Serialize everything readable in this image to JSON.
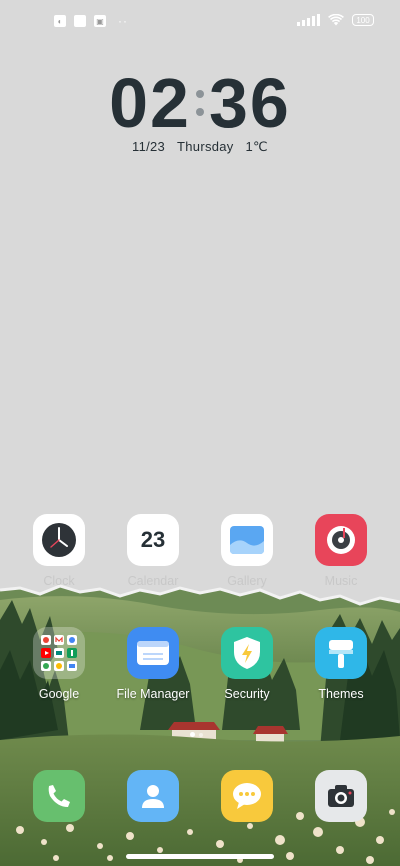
{
  "status_bar": {
    "left_icons": [
      "mi-icon",
      "square-icon",
      "notification-icon"
    ],
    "overflow": "··",
    "battery": "100"
  },
  "clock": {
    "hour": "02",
    "minute": "36",
    "date": "11/23",
    "weekday": "Thursday",
    "temperature": "1℃"
  },
  "apps_row1": [
    {
      "label": "Clock",
      "icon": "clock-icon"
    },
    {
      "label": "Calendar",
      "icon": "calendar-icon",
      "day": "23"
    },
    {
      "label": "Gallery",
      "icon": "gallery-icon"
    },
    {
      "label": "Music",
      "icon": "music-icon"
    }
  ],
  "apps_row2": [
    {
      "label": "Google",
      "icon": "folder-icon"
    },
    {
      "label": "File Manager",
      "icon": "file-manager-icon"
    },
    {
      "label": "Security",
      "icon": "security-icon"
    },
    {
      "label": "Themes",
      "icon": "themes-icon"
    }
  ],
  "dock": [
    {
      "icon": "phone-icon"
    },
    {
      "icon": "contacts-icon"
    },
    {
      "icon": "messages-icon"
    },
    {
      "icon": "camera-icon"
    }
  ],
  "colors": {
    "background": "#d9d9d9",
    "clock_text": "#263036",
    "music_red": "#e8455a",
    "file_blue": "#3f8cf2",
    "security_green": "#2ec4a0",
    "themes_blue": "#2fb7e8",
    "phone_green": "#67bf6e",
    "contacts_blue": "#63b5f6",
    "messages_yellow": "#f8c93c"
  }
}
